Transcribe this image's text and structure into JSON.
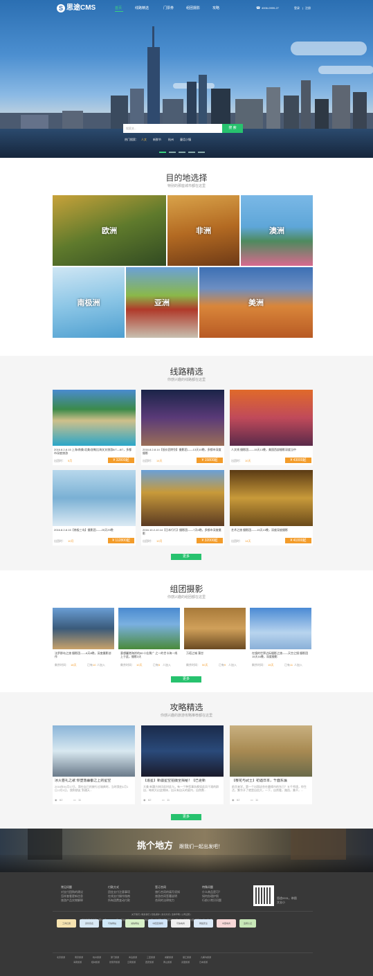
{
  "header": {
    "logo_letter": "S",
    "logo_text": "思途CMS",
    "nav": [
      "首页",
      "线路精选",
      "门票券",
      "组团摄影",
      "攻略"
    ],
    "phone": "4006-0999-27",
    "login": "登录",
    "register": "注册"
  },
  "hero": {
    "search_placeholder": "搜索关...",
    "search_button": "搜 索",
    "hot_label": "热门搜索：",
    "hot_items": [
      "人文",
      "新鲜节",
      "杭州",
      "童话小镇"
    ]
  },
  "destinations": {
    "title": "目的地选择",
    "subtitle": "特别的那座城市都在这里",
    "items": [
      "欧洲",
      "非洲",
      "澳洲",
      "南极洲",
      "亚洲",
      "美洲"
    ]
  },
  "routes": {
    "title": "线路精选",
    "subtitle": "你感兴趣的线路都在这里",
    "more": "更多",
    "items": [
      {
        "desc": "2016.8.2-8.15 上海/南美/北美/加勒比海叉叉旅游8/7—8/7，多都市深度旅游",
        "label": "出团时：",
        "label_val": "5月",
        "price": "¥ 32800起"
      },
      {
        "desc": "2016.8.2-8.14【低价团特别】摄影团——13天10晚，多都市深度摄影",
        "label": "出团时：",
        "label_val": "14天",
        "price": "¥ 15800起"
      },
      {
        "desc": "人文线 摄影团——15天13晚，美国西部摄影深度当中",
        "label": "出团时：",
        "label_val": "10天",
        "price": "¥ 43000起"
      },
      {
        "desc": "2016.8.2-8.15【南极三岛】摄影团——25天29晚",
        "label": "出团时：",
        "label_val": "10月",
        "price": "¥ 112800起"
      },
      {
        "desc": "2016.10.2-10.14【日本行行】摄影团——7天6晚，多都市深度摄影",
        "label": "出团时：",
        "label_val": "10月",
        "price": "¥ 32000起"
      },
      {
        "desc": "艺术之旅 摄影团——15天13晚，深度深度摄影",
        "label": "出团时：",
        "label_val": "14天",
        "price": "¥ 41000起"
      }
    ]
  },
  "photo": {
    "title": "组团摄影",
    "subtitle": "你感兴趣的组团都在这里",
    "more": "更多",
    "items": [
      {
        "desc": "法罗群岛之旅 摄影团——8天8晚，深度摄影创作",
        "l1": "剩余时间：",
        "v1": "18天",
        "l2": "已有",
        "v2": "10",
        "l3": "人加入"
      },
      {
        "desc": "意想麗港海岸的5D十佳景广 之一的世卡海一线上于此，摄影3天",
        "l1": "剩余时间：",
        "v1": "10天",
        "l2": "已有",
        "v2": "5",
        "l3": "人加入"
      },
      {
        "desc": "万塔之城 蒲甘",
        "l1": "剩余时间：",
        "v1": "50天",
        "l2": "已有",
        "v2": "9",
        "l3": "人加入"
      },
      {
        "desc": "在镜的世界边际摄影之旅——天空之镜 摄影团15天16晚，深度摄影",
        "l1": "剩余时间：",
        "v1": "15天",
        "l2": "已有",
        "v2": "11",
        "l3": "人加入"
      }
    ]
  },
  "guide": {
    "title": "攻略精选",
    "subtitle": "你感兴趣的旅游攻略推荐都在这里",
    "more": "更多",
    "items": [
      {
        "title": "冰火甚礼之歌 你堕落暮都之上的星空",
        "text": "2016年04月17日，我在自已的旅行过瑞典时，当时我由1月1日-2月1日，我和朋友 到通天...",
        "c1": "62",
        "c2": "11"
      },
      {
        "title": "【追星】新疆星空拍摄全揭秘！【已更新",
        "text": "大美 新疆方刻印此时此与，有一个种您事务都如此风干观的群自，每刻大幻此物体，自天有自天的星内，自然数...",
        "c1": "62",
        "c2": "11"
      },
      {
        "title": "【樱花与武士】初遇日本，千面东瀛",
        "text": "前言来学，第一个出国这些在最缘内的东日？五千秀境，你生活，繁华开了就是自由大，一下，自然看，路由，美不，...",
        "c1": "62",
        "c2": "11"
      }
    ]
  },
  "banner": {
    "big": "挑个地方",
    "small": "跟我们一起出发吧！"
  },
  "footer": {
    "cols": [
      {
        "head": "常见问题",
        "links": [
          "对支付团购的建议",
          "怎样查看更新信息",
          "旅游产品实物解释"
        ]
      },
      {
        "head": "付款方式",
        "links": [
          "团金支付注意事项",
          "在线支付操作指南",
          "所有团费变动付款"
        ]
      },
      {
        "head": "签订合同",
        "links": [
          "旅行合同的填写须知",
          "旅游合同签署说明",
          "合同的法律效力"
        ]
      },
      {
        "head": "特殊问题",
        "links": [
          "什么商品是可？",
          "如何办理护照",
          "行前小常识问题"
        ]
      }
    ],
    "qr_text": "思途0931，带图文去小",
    "nav_row": "关于我们 | 联系我们 | 隐私保护 | 支付方式 | 法律声明 | 公司证照 |",
    "info_row": "思途集团       备案号：蜀ICP备 88039168号-6       咨询热线：4006-0999-27       地址：四川省成都市高新区某地大厦A幢18楼号号内部1号国内2幢22楼1号",
    "badges": [
      "工商红盾",
      "身份实名",
      "可信网站",
      "诚信网站",
      "中国互联网",
      "可信电商",
      "网络安全",
      "中国电商",
      "监督认证"
    ],
    "links_a": [
      "北京旅游",
      "南京旅游",
      "杭州旅游",
      "厦门旅游",
      "青岛旅游",
      "三亚旅游",
      "成都旅游",
      "丽江旅游",
      "九寨沟旅游"
    ],
    "links_b": [
      "海南旅游",
      "桂林旅游",
      "张家界旅游",
      "云南旅游",
      "西安旅游",
      "黄山旅游",
      "泰国旅游",
      "日本旅游"
    ]
  },
  "colors": {
    "accent": "#27c26e",
    "price": "#f39c2a",
    "footer": "#383838"
  }
}
